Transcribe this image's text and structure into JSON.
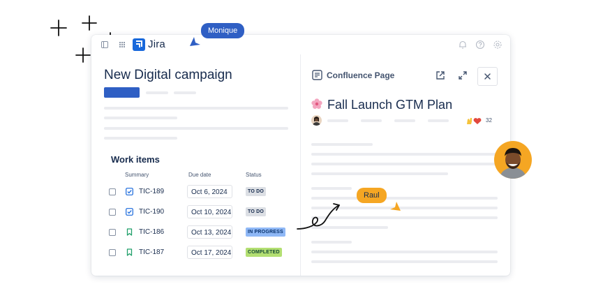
{
  "app": {
    "name": "Jira",
    "icons": [
      "sidebar-toggle-icon",
      "apps-grid-icon",
      "jira-logo-icon",
      "notifications-icon",
      "help-icon",
      "settings-icon"
    ]
  },
  "issue": {
    "title": "New Digital campaign"
  },
  "work_items": {
    "title": "Work items",
    "columns": [
      "Summary",
      "Due date",
      "Status"
    ],
    "rows": [
      {
        "key": "TIC-189",
        "type": "task",
        "due": "Oct 6, 2024",
        "status": "TO DO"
      },
      {
        "key": "TIC-190",
        "type": "task",
        "due": "Oct 10, 2024",
        "status": "TO DO"
      },
      {
        "key": "TIC-186",
        "type": "story",
        "due": "Oct 13, 2024",
        "status": "IN PROGRESS"
      },
      {
        "key": "TIC-187",
        "type": "story",
        "due": "Oct 17, 2024",
        "status": "COMPLETED"
      }
    ],
    "status_colors": {
      "TO DO": {
        "bg": "#dcdfe4",
        "fg": "#172b4d"
      },
      "IN PROGRESS": {
        "bg": "#8fb8f6",
        "fg": "#09326c"
      },
      "COMPLETED": {
        "bg": "#b3df72",
        "fg": "#164b35"
      }
    }
  },
  "confluence": {
    "label": "Confluence Page",
    "doc_title": "Fall Launch GTM Plan",
    "reaction_count": "32",
    "icons": [
      "confluence-page-icon",
      "open-external-icon",
      "expand-icon",
      "close-icon",
      "flower-emoji-icon",
      "reactions-icon"
    ]
  },
  "collaborators": {
    "monique": {
      "name": "Monique",
      "color": "#2f5fc4"
    },
    "raul": {
      "name": "Raul",
      "color": "#f5a623"
    }
  },
  "colors": {
    "brand_blue": "#1868db",
    "accent_blue": "#2f5fc4",
    "accent_orange": "#f5a623",
    "placeholder_gray": "#ebecf0"
  }
}
